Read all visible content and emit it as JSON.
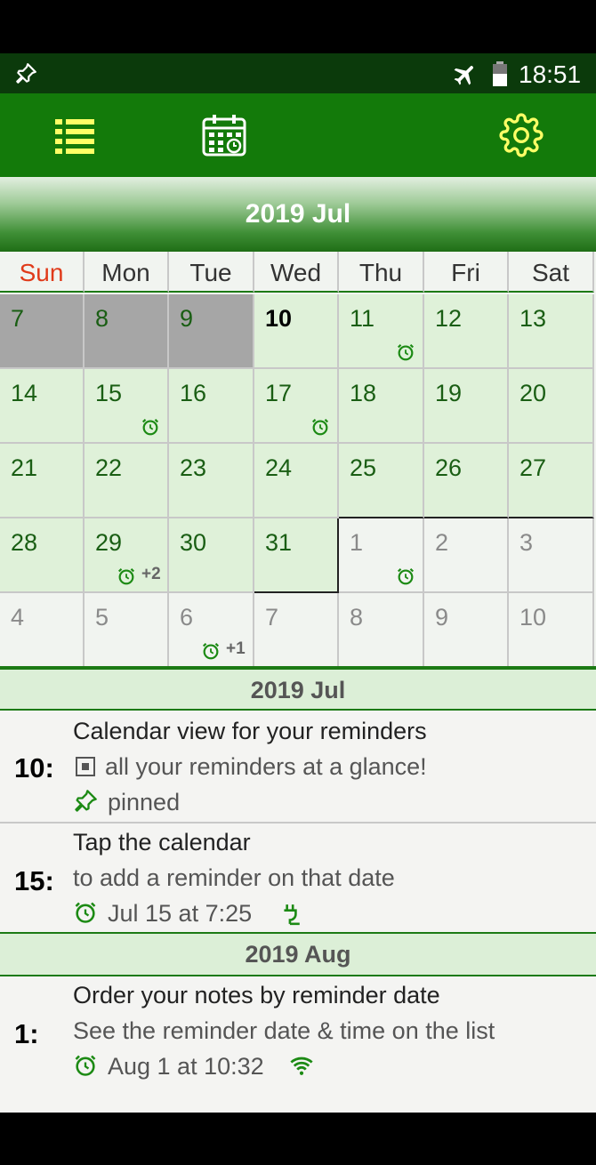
{
  "status_bar": {
    "time": "18:51"
  },
  "header": {
    "month_title": "2019 Jul"
  },
  "calendar": {
    "weekdays": [
      "Sun",
      "Mon",
      "Tue",
      "Wed",
      "Thu",
      "Fri",
      "Sat"
    ],
    "weeks": [
      [
        {
          "d": "7"
        },
        {
          "d": "8"
        },
        {
          "d": "9"
        },
        {
          "d": "10"
        },
        {
          "d": "11",
          "alarm": true
        },
        {
          "d": "12"
        },
        {
          "d": "13"
        }
      ],
      [
        {
          "d": "14"
        },
        {
          "d": "15",
          "alarm": true
        },
        {
          "d": "16"
        },
        {
          "d": "17",
          "alarm": true
        },
        {
          "d": "18"
        },
        {
          "d": "19"
        },
        {
          "d": "20"
        }
      ],
      [
        {
          "d": "21"
        },
        {
          "d": "22"
        },
        {
          "d": "23"
        },
        {
          "d": "24"
        },
        {
          "d": "25"
        },
        {
          "d": "26"
        },
        {
          "d": "27"
        }
      ],
      [
        {
          "d": "28"
        },
        {
          "d": "29",
          "alarm": true,
          "more": "+2"
        },
        {
          "d": "30"
        },
        {
          "d": "31"
        },
        {
          "d": "1",
          "alarm": true
        },
        {
          "d": "2"
        },
        {
          "d": "3"
        }
      ],
      [
        {
          "d": "4"
        },
        {
          "d": "5"
        },
        {
          "d": "6",
          "alarm": true,
          "more": "+1"
        },
        {
          "d": "7"
        },
        {
          "d": "8"
        },
        {
          "d": "9"
        },
        {
          "d": "10"
        }
      ]
    ]
  },
  "list": {
    "sections": [
      {
        "title": "2019 Jul"
      },
      {
        "title": "2019 Aug"
      }
    ],
    "items": [
      {
        "day": "10:",
        "title": "Calendar view for your reminders",
        "line2": "all your reminders at a glance!",
        "meta": "pinned"
      },
      {
        "day": "15:",
        "title": "Tap the calendar",
        "line2": "to add a reminder on that date",
        "meta": "Jul 15 at 7:25"
      },
      {
        "day": "1:",
        "title": "Order your notes by reminder date",
        "line2": "See the reminder date & time on the list",
        "meta": "Aug 1 at 10:32"
      }
    ]
  },
  "colors": {
    "accent_green": "#137a0a",
    "icon_yellow": "#ffff66",
    "sunday_red": "#e03a1a"
  }
}
